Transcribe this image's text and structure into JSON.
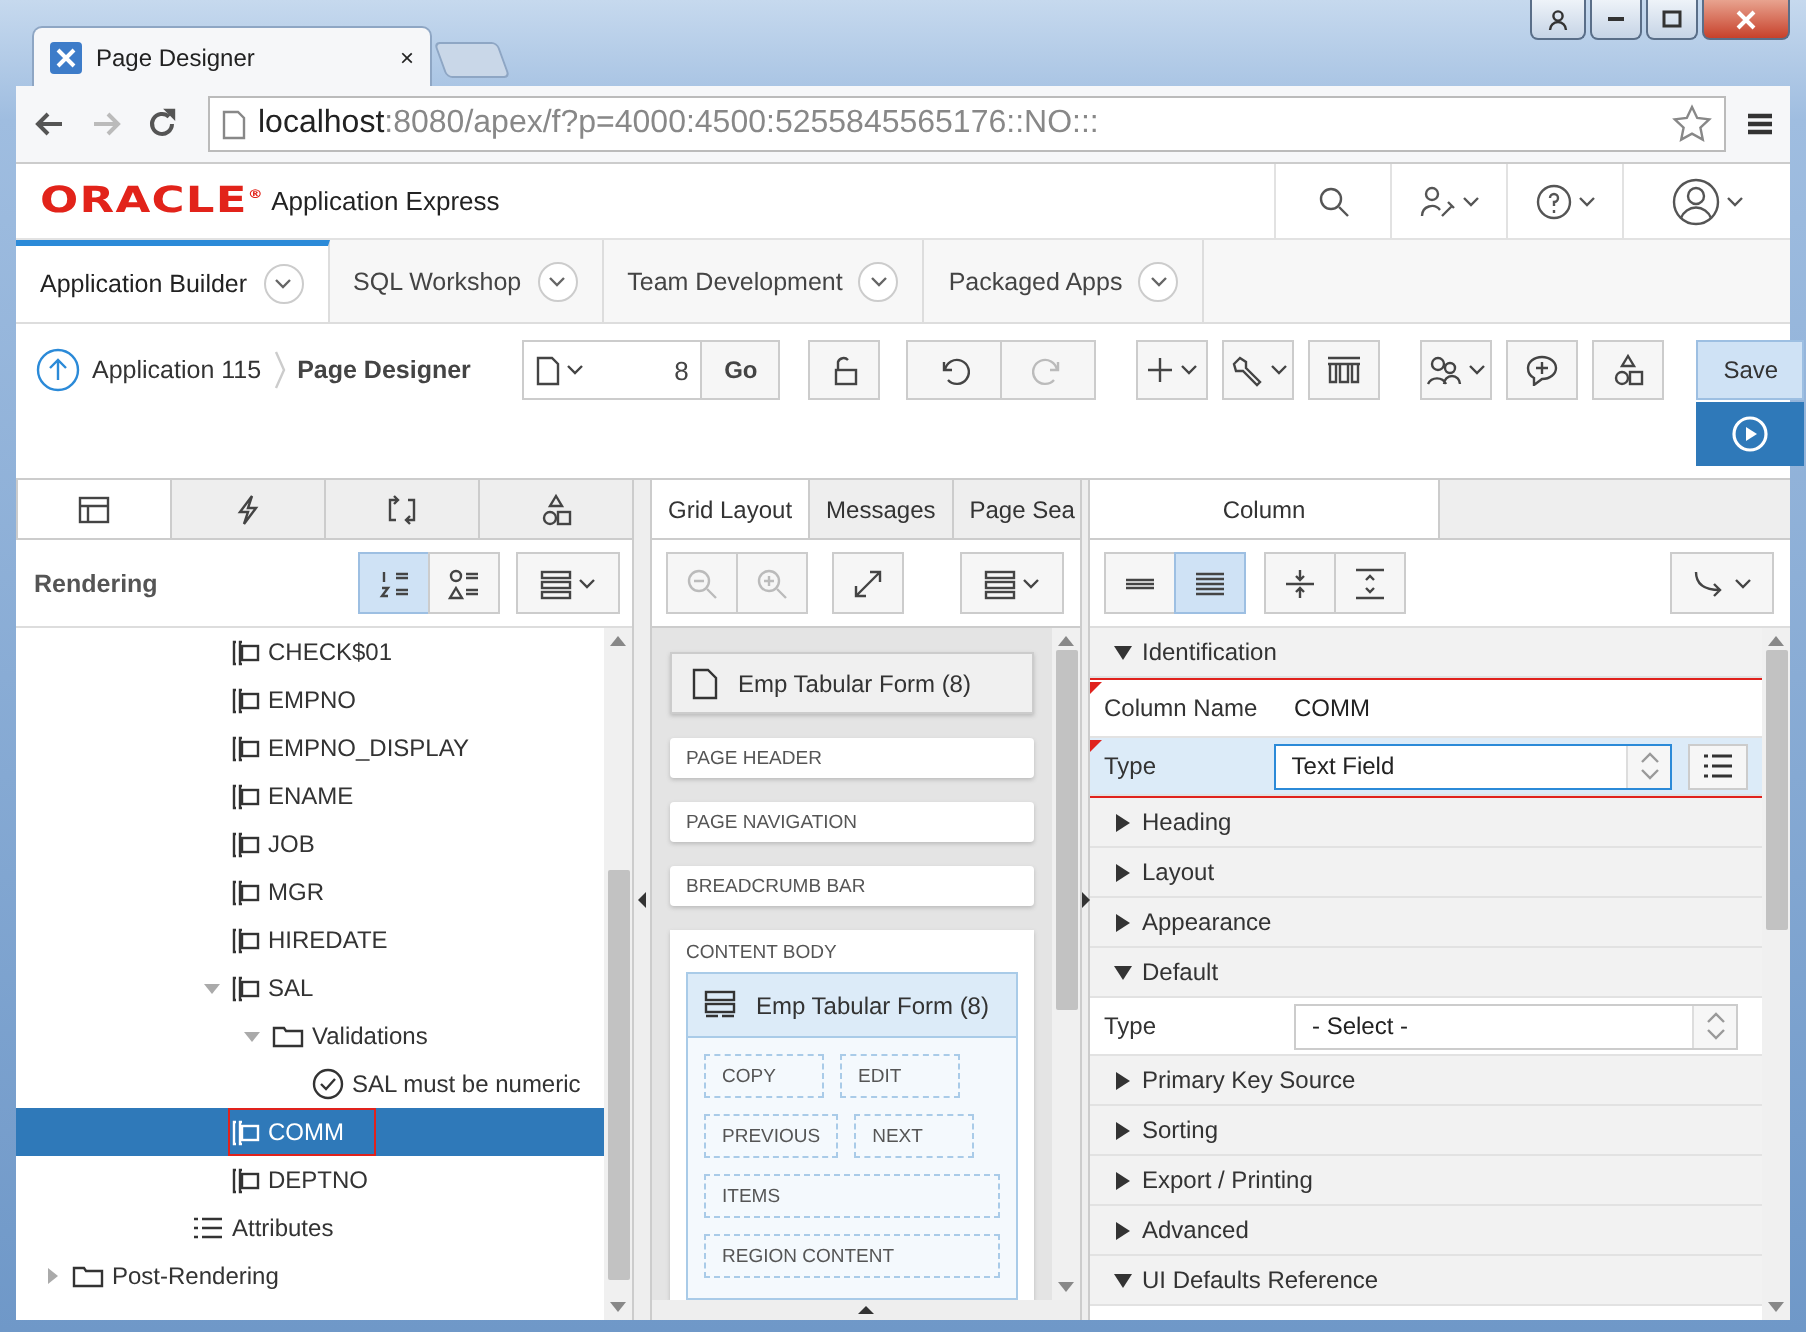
{
  "browser": {
    "tab": {
      "title": "Page Designer",
      "close": "×"
    },
    "nav_buttons": [
      {
        "kind": "back",
        "disabled": false
      },
      {
        "kind": "forward",
        "disabled": true
      },
      {
        "kind": "reload",
        "disabled": false
      }
    ],
    "url": {
      "host": "localhost",
      "rest": ":8080/apex/f?p=4000:4500:5255845565176::NO:::"
    }
  },
  "header": {
    "logo": "ORACLE",
    "logo_mark": "®",
    "product": "Application Express"
  },
  "nav_tabs": [
    {
      "label": "Application Builder",
      "selected": true
    },
    {
      "label": "SQL Workshop",
      "selected": false
    },
    {
      "label": "Team Development",
      "selected": false
    },
    {
      "label": "Packaged Apps",
      "selected": false
    }
  ],
  "toolbar": {
    "breadcrumb": [
      "Application 115",
      "Page Designer"
    ],
    "page_number": "8",
    "go": "Go",
    "save": "Save",
    "undo_disabled": false,
    "redo_disabled": true
  },
  "left_panel": {
    "tabs": [
      {
        "kind": "rendering",
        "selected": true
      },
      {
        "kind": "dynamic",
        "selected": false
      },
      {
        "kind": "processing",
        "selected": false
      },
      {
        "kind": "shared",
        "selected": false
      }
    ],
    "title": "Rendering",
    "view_buttons": [
      {
        "kind": "numbered",
        "selected": true
      },
      {
        "kind": "grouped",
        "selected": false
      }
    ],
    "tree": [
      {
        "children": [
          {
            "children": [
              {
                "children": [
                  {
                    "children": [
                      {
                        "label": "CHECK$01",
                        "kind": "column",
                        "selected": false
                      },
                      {
                        "label": "EMPNO",
                        "kind": "column",
                        "selected": false
                      },
                      {
                        "label": "EMPNO_DISPLAY",
                        "kind": "column",
                        "selected": false
                      },
                      {
                        "label": "ENAME",
                        "kind": "column",
                        "selected": false
                      },
                      {
                        "label": "JOB",
                        "kind": "column",
                        "selected": false
                      },
                      {
                        "label": "MGR",
                        "kind": "column",
                        "selected": false
                      },
                      {
                        "label": "HIREDATE",
                        "kind": "column",
                        "selected": false
                      },
                      {
                        "label": "SAL",
                        "kind": "column",
                        "selected": false,
                        "expanded": true,
                        "children": [
                          {
                            "label": "Validations",
                            "kind": "folder",
                            "selected": false,
                            "expanded": true,
                            "children": [
                              {
                                "label": "SAL must be numeric",
                                "kind": "validation",
                                "selected": false
                              }
                            ]
                          }
                        ]
                      },
                      {
                        "label": "COMM",
                        "kind": "column",
                        "selected": true,
                        "annotated": true
                      },
                      {
                        "label": "DEPTNO",
                        "kind": "column",
                        "selected": false
                      }
                    ]
                  },
                  {
                    "label": "Attributes",
                    "kind": "attributes",
                    "selected": false
                  }
                ]
              }
            ]
          }
        ]
      },
      {
        "label": "Post-Rendering",
        "kind": "folder",
        "selected": false,
        "expanded": false
      }
    ]
  },
  "middle_panel": {
    "tabs": [
      {
        "label": "Grid Layout",
        "selected": true
      },
      {
        "label": "Messages",
        "selected": false
      },
      {
        "label": "Page Sea",
        "selected": false
      }
    ],
    "page_title": "Emp Tabular Form (8)",
    "regions": [
      "PAGE HEADER",
      "PAGE NAVIGATION",
      "BREADCRUMB BAR"
    ],
    "content_body": {
      "label": "CONTENT BODY",
      "region": "Emp Tabular Form (8)",
      "slots": [
        [
          "COPY",
          "EDIT"
        ],
        [
          "PREVIOUS",
          "NEXT"
        ],
        [
          "ITEMS"
        ],
        [
          "REGION CONTENT"
        ]
      ]
    }
  },
  "right_panel": {
    "tab": "Column",
    "density_buttons": [
      {
        "kind": "compact",
        "selected": false
      },
      {
        "kind": "expanded",
        "selected": true
      }
    ],
    "groups": [
      {
        "label": "Identification",
        "expanded": true,
        "annotated": true,
        "properties": [
          {
            "label": "Column Name",
            "value": "COMM",
            "kind": "text",
            "required": true,
            "selected": false
          },
          {
            "label": "Type",
            "value": "Text Field",
            "kind": "select",
            "required": true,
            "selected": true
          }
        ]
      },
      {
        "label": "Heading",
        "expanded": false
      },
      {
        "label": "Layout",
        "expanded": false
      },
      {
        "label": "Appearance",
        "expanded": false
      },
      {
        "label": "Default",
        "expanded": true,
        "properties": [
          {
            "label": "Type",
            "value": "- Select -",
            "kind": "select",
            "required": false,
            "selected": false
          }
        ]
      },
      {
        "label": "Primary Key Source",
        "expanded": false
      },
      {
        "label": "Sorting",
        "expanded": false
      },
      {
        "label": "Export / Printing",
        "expanded": false
      },
      {
        "label": "Advanced",
        "expanded": false
      },
      {
        "label": "UI Defaults Reference",
        "expanded": true
      }
    ]
  }
}
